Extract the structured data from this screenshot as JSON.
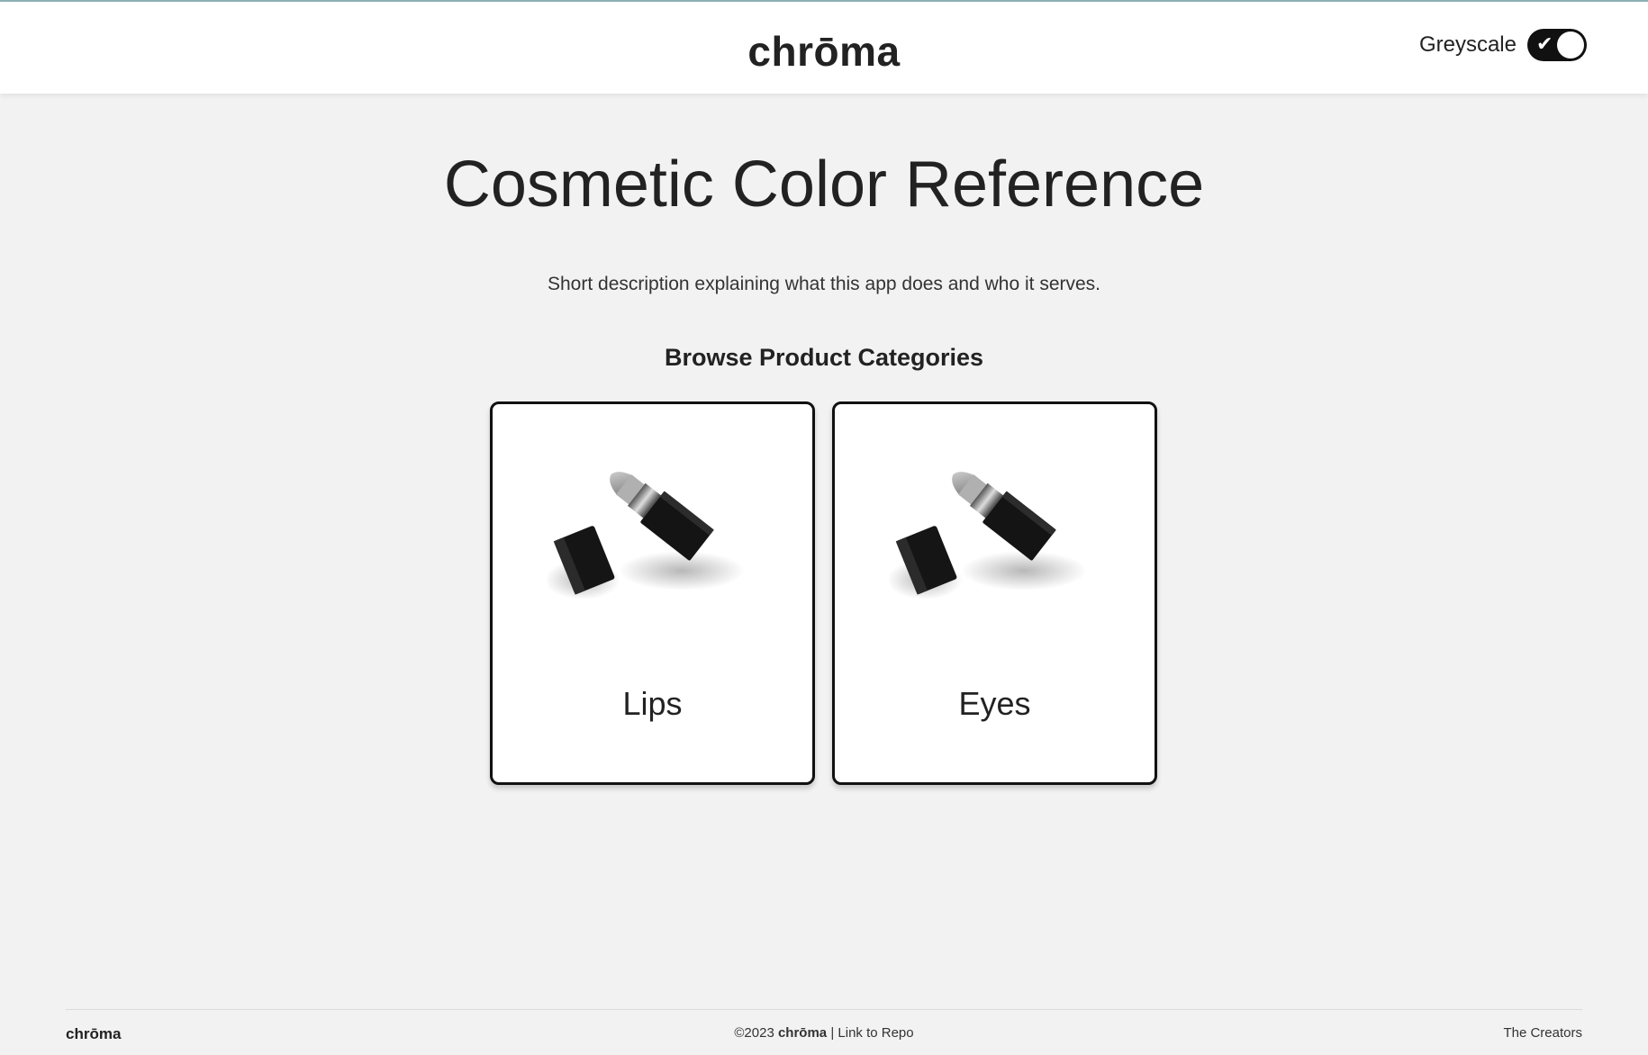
{
  "header": {
    "logo": "chrōma",
    "toggle_label": "Greyscale",
    "toggle_on": true
  },
  "main": {
    "title": "Cosmetic Color Reference",
    "description": "Short description explaining what this app does and who it serves.",
    "section_heading": "Browse Product Categories",
    "categories": [
      {
        "label": "Lips",
        "image": "lipstick-image"
      },
      {
        "label": "Eyes",
        "image": "lipstick-image"
      }
    ]
  },
  "footer": {
    "logo": "chrōma",
    "copyright": "©2023",
    "brand": "chrōma",
    "separator": "|",
    "repo_link": "Link to Repo",
    "creators_link": "The Creators"
  },
  "colors": {
    "background": "#f2f2f2",
    "header_bg": "#ffffff",
    "accent": "#111111",
    "top_rule": "#8fb3b5"
  }
}
